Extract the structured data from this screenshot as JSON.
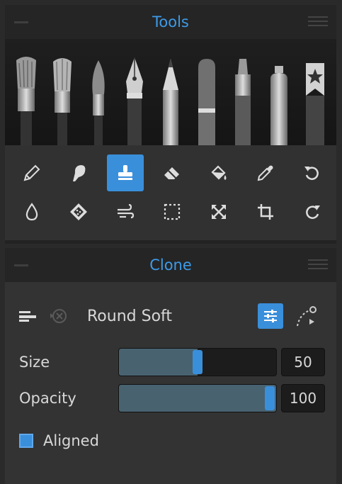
{
  "tools_panel": {
    "title": "Tools",
    "brushes": [
      "oil-brush",
      "flat-brush",
      "round-brush",
      "pen-nib",
      "pencil",
      "marker",
      "felt-pen",
      "spray-can",
      "favorites-bookmark"
    ],
    "tools_row1": [
      "pencil-tool",
      "smudge-tool",
      "clone-stamp-tool",
      "eraser-tool",
      "fill-bucket-tool",
      "eyedropper-tool",
      "undo"
    ],
    "tools_row2": [
      "water-drop-tool",
      "texture-tool",
      "blend-wind-tool",
      "selection-tool",
      "transform-tool",
      "crop-tool",
      "redo"
    ],
    "active_tool": "clone-stamp-tool"
  },
  "clone_panel": {
    "title": "Clone",
    "brush_name": "Round Soft",
    "size": {
      "label": "Size",
      "value": "50",
      "fraction": 0.5
    },
    "opacity": {
      "label": "Opacity",
      "value": "100",
      "fraction": 1.0
    },
    "aligned": {
      "label": "Aligned",
      "checked": true
    }
  },
  "colors": {
    "accent": "#3a8fdb",
    "title": "#3d9be9",
    "header_bg": "#252525",
    "panel_bg": "#313131"
  }
}
